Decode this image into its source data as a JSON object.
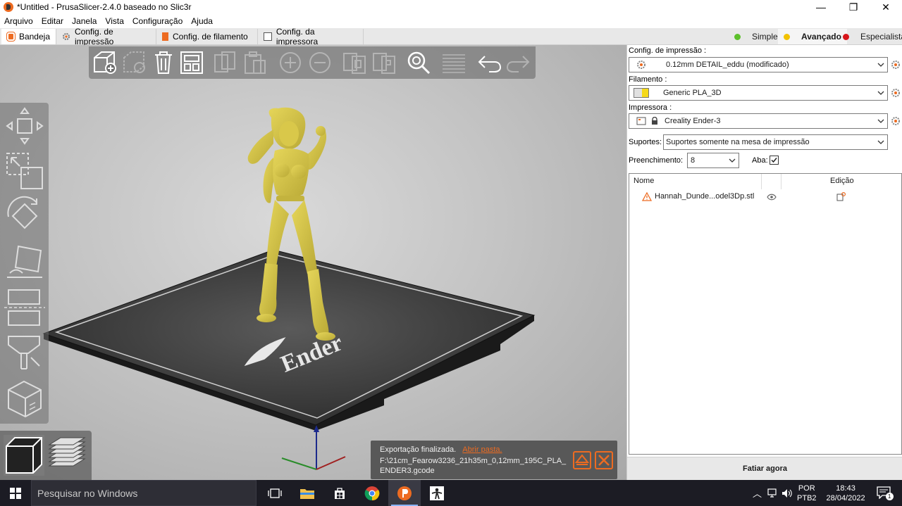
{
  "window": {
    "title": "*Untitled - PrusaSlicer-2.4.0 baseado no Slic3r",
    "minimize": "—",
    "maximize": "❐",
    "close": "✕"
  },
  "menu": [
    "Arquivo",
    "Editar",
    "Janela",
    "Vista",
    "Configuração",
    "Ajuda"
  ],
  "tabs": [
    {
      "label": "Bandeja",
      "icon": "plater-icon"
    },
    {
      "label": "Config. de impressão",
      "icon": "print-settings-icon"
    },
    {
      "label": "Config. de filamento",
      "icon": "filament-icon"
    },
    {
      "label": "Config. da impressora",
      "icon": "printer-icon"
    }
  ],
  "modes": [
    {
      "label": "Simples",
      "color": "#5cc02b"
    },
    {
      "label": "Avançado",
      "color": "#f2c200",
      "selected": true
    },
    {
      "label": "Especialista",
      "color": "#d8161b"
    }
  ],
  "viewport": {
    "bed_logo_text": "Ender",
    "model_color": "#d9c84a",
    "top_toolbar_icons": [
      "add-icon",
      "delete-icon",
      "delete-all-icon",
      "arrange-icon",
      "copy-icon",
      "paste-icon",
      "add-instance-icon",
      "remove-instance-icon",
      "split-objects-icon",
      "split-parts-icon",
      "search-icon",
      "layers-editing-icon",
      "undo-icon",
      "redo-icon"
    ],
    "left_toolbar_icons": [
      "move-icon",
      "scale-icon",
      "rotate-icon",
      "place-on-face-icon",
      "cut-icon",
      "paint-supports-icon",
      "seam-painting-icon"
    ],
    "view_icons": [
      "3d-view-icon",
      "preview-icon"
    ]
  },
  "notification": {
    "message": "Exportação finalizada.",
    "link": "Abrir pasta.",
    "path": "F:\\21cm_Fearow3236_21h35m_0,12mm_195C_PLA_ENDER3.gcode"
  },
  "panel": {
    "print_label": "Config. de impressão :",
    "print_value": "0.12mm DETAIL_eddu (modificado)",
    "filament_label": "Filamento :",
    "filament_value": "Generic PLA_3D",
    "filament_color": "#f5d91a",
    "printer_label": "Impressora :",
    "printer_value": "Creality Ender-3",
    "supports_label": "Suportes:",
    "supports_value": "Suportes somente na mesa de impressão",
    "infill_label": "Preenchimento:",
    "infill_value": "8",
    "brim_label": "Aba:",
    "brim_checked": true,
    "list_col_name": "Nome",
    "list_col_edit": "Edição",
    "objects": [
      {
        "name": "Hannah_Dunde...odel3Dp.stl",
        "warning": true
      }
    ],
    "slice_button": "Fatiar agora"
  },
  "taskbar": {
    "search_placeholder": "Pesquisar no Windows",
    "lang_top": "POR",
    "lang_bottom": "PTB2",
    "time": "18:43",
    "date": "28/04/2022",
    "notifications": "1"
  }
}
